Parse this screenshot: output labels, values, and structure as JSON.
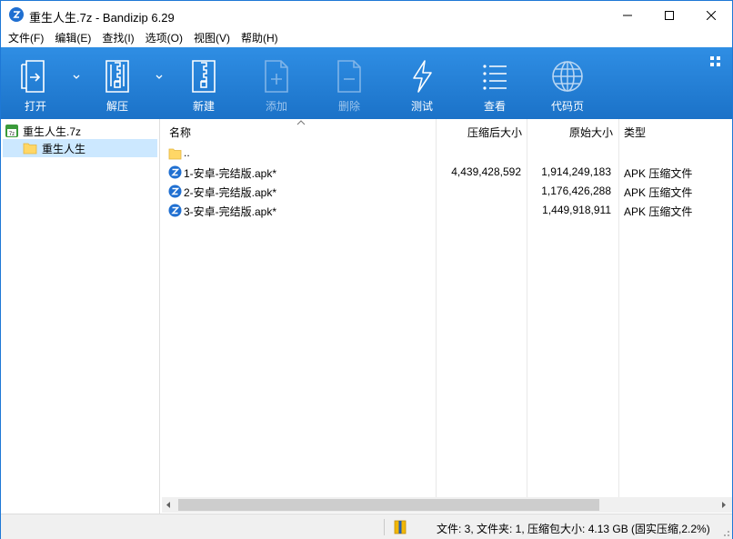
{
  "window": {
    "title": "重生人生.7z - Bandizip 6.29",
    "accent_color": "#1e78d6"
  },
  "menu": [
    "文件(F)",
    "编辑(E)",
    "查找(I)",
    "选项(O)",
    "视图(V)",
    "帮助(H)"
  ],
  "toolbar": {
    "buttons": [
      {
        "label": "打开",
        "icon": "open-archive-icon",
        "enabled": true
      },
      {
        "label": "解压",
        "icon": "extract-icon",
        "enabled": true
      },
      {
        "label": "新建",
        "icon": "new-archive-icon",
        "enabled": true
      },
      {
        "label": "添加",
        "icon": "add-icon",
        "enabled": false
      },
      {
        "label": "删除",
        "icon": "delete-icon",
        "enabled": false
      },
      {
        "label": "测试",
        "icon": "test-lightning-icon",
        "enabled": true
      },
      {
        "label": "查看",
        "icon": "view-list-icon",
        "enabled": true
      },
      {
        "label": "代码页",
        "icon": "codepage-globe-icon",
        "enabled": false
      }
    ],
    "background_color": "#2580d8"
  },
  "tree": {
    "root": "重生人生.7z",
    "child": "重生人生"
  },
  "list": {
    "columns": [
      "名称",
      "压缩后大小",
      "原始大小",
      "类型"
    ],
    "parent_row": "..",
    "rows": [
      {
        "name": "1-安卓-完结版.apk*",
        "compressed": "4,439,428,592",
        "original": "1,914,249,183",
        "type": "APK 压缩文件"
      },
      {
        "name": "2-安卓-完结版.apk*",
        "compressed": "",
        "original": "1,176,426,288",
        "type": "APK 压缩文件"
      },
      {
        "name": "3-安卓-完结版.apk*",
        "compressed": "",
        "original": "1,449,918,911",
        "type": "APK 压缩文件"
      }
    ]
  },
  "status": {
    "text": "文件: 3, 文件夹: 1, 压缩包大小: 4.13 GB (固实压缩,2.2%)"
  }
}
